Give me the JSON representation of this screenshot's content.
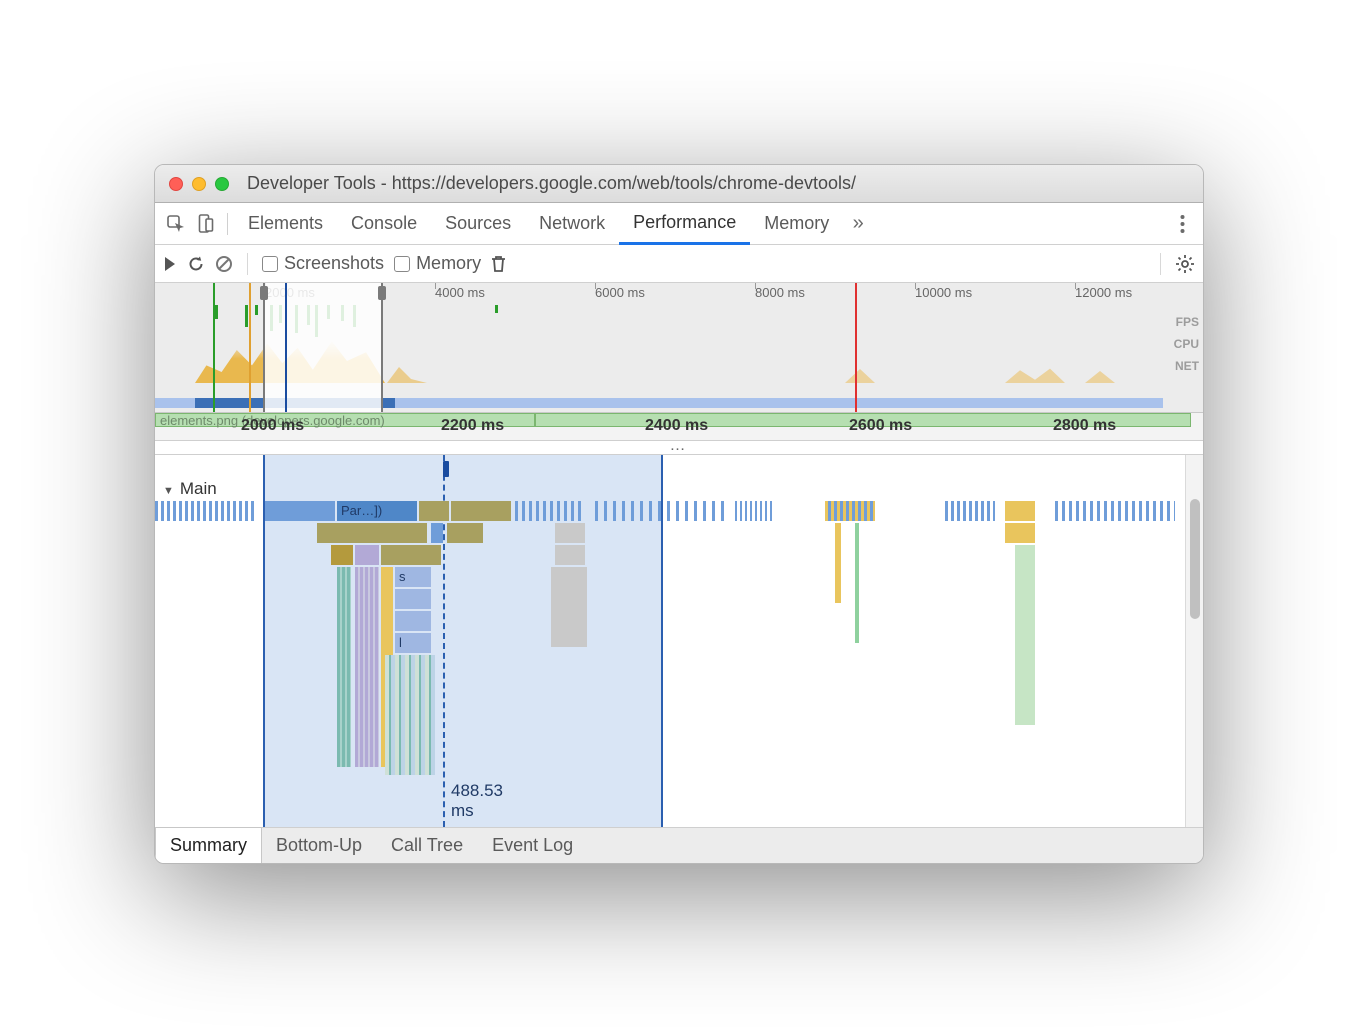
{
  "window": {
    "title": "Developer Tools - https://developers.google.com/web/tools/chrome-devtools/"
  },
  "tabs": {
    "items": [
      "Elements",
      "Console",
      "Sources",
      "Network",
      "Performance",
      "Memory"
    ],
    "active_index": 4
  },
  "toolbar": {
    "screenshots_label": "Screenshots",
    "memory_label": "Memory"
  },
  "overview": {
    "ticks": [
      "2000 ms",
      "4000 ms",
      "6000 ms",
      "8000 ms",
      "10000 ms",
      "12000 ms"
    ],
    "lanes": [
      "FPS",
      "CPU",
      "NET"
    ]
  },
  "time_ruler": {
    "ticks": [
      "2000 ms",
      "2200 ms",
      "2400 ms",
      "2600 ms",
      "2800 ms"
    ],
    "network_item": "elements.png (developers.google.com)"
  },
  "flame": {
    "section": "Main",
    "parse_label": "Par…])",
    "s_label": "s",
    "l_label": "l",
    "cursor_label": "488.53 ms"
  },
  "bottom_tabs": {
    "items": [
      "Summary",
      "Bottom-Up",
      "Call Tree",
      "Event Log"
    ],
    "active_index": 0
  },
  "colors": {
    "scripting": "#e9c55d",
    "scripting_dark": "#b49a3d",
    "rendering": "#9fb7e2",
    "painting": "#8fd19e",
    "system": "#c9c9c9",
    "blue": "#6f9dd9",
    "blue_dark": "#2b5fb0",
    "olive": "#a8a060",
    "teal": "#7bbab0"
  }
}
